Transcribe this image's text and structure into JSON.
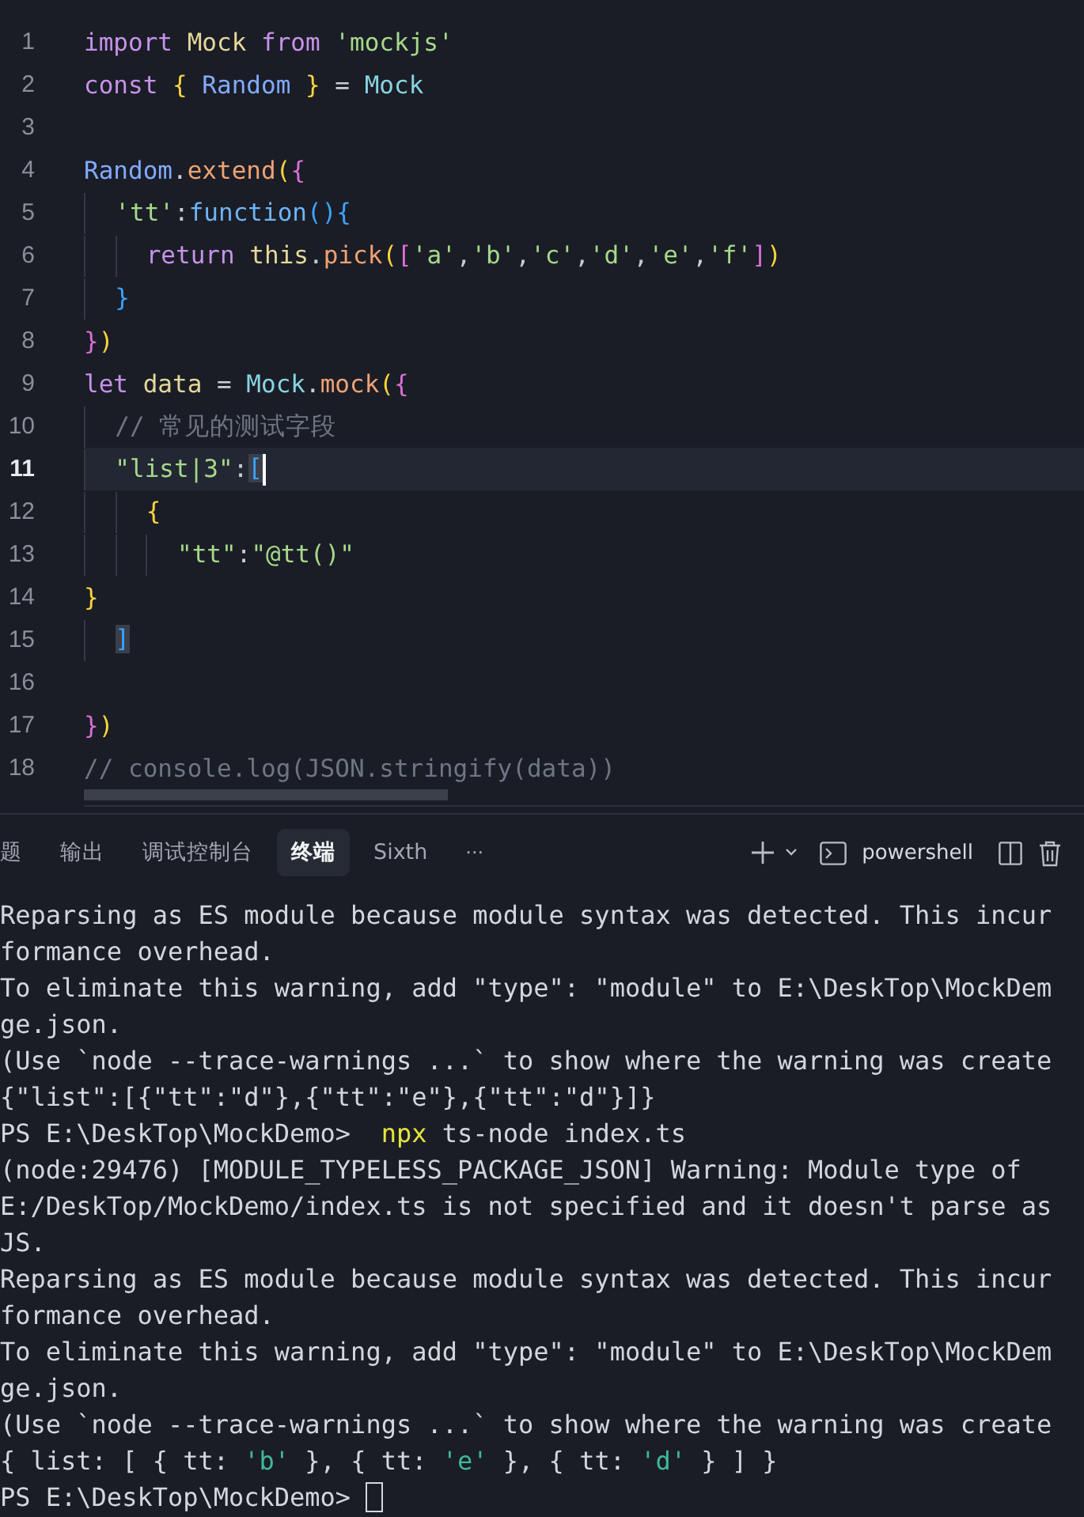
{
  "editor": {
    "lines": [
      {
        "number": "1",
        "current": false,
        "tokens": [
          {
            "kind": "kw",
            "text": "import"
          },
          {
            "kind": "ident",
            "text": " Mock"
          },
          {
            "kind": "kw",
            "text": " from"
          },
          {
            "kind": "str",
            "text": " 'mockjs'"
          }
        ]
      },
      {
        "number": "2",
        "current": false,
        "tokens": [
          {
            "kind": "kw",
            "text": "const"
          },
          {
            "kind": "b1",
            "text": " {"
          },
          {
            "kind": "var",
            "text": " Random"
          },
          {
            "kind": "b1",
            "text": " }"
          },
          {
            "kind": "plain",
            "text": " = "
          },
          {
            "kind": "type",
            "text": "Mock"
          }
        ]
      },
      {
        "number": "3",
        "current": false
      },
      {
        "number": "4",
        "current": false,
        "tokens": [
          {
            "kind": "var",
            "text": "Random"
          },
          {
            "kind": "plain",
            "text": "."
          },
          {
            "kind": "method",
            "text": "extend"
          },
          {
            "kind": "b1",
            "text": "("
          },
          {
            "kind": "b2",
            "text": "{"
          }
        ]
      },
      {
        "number": "5",
        "current": false,
        "tokens": [
          {
            "kind": "str",
            "text": "  'tt'"
          },
          {
            "kind": "plain",
            "text": ":"
          },
          {
            "kind": "fn",
            "text": "function"
          },
          {
            "kind": "b3",
            "text": "(){"
          }
        ]
      },
      {
        "number": "6",
        "current": false,
        "tokens": [
          {
            "kind": "kw",
            "text": "    return"
          },
          {
            "kind": "ident",
            "text": " this"
          },
          {
            "kind": "plain",
            "text": "."
          },
          {
            "kind": "method",
            "text": "pick"
          },
          {
            "kind": "b1",
            "text": "("
          },
          {
            "kind": "b2",
            "text": "["
          },
          {
            "kind": "str",
            "text": "'a'"
          },
          {
            "kind": "plain",
            "text": ","
          },
          {
            "kind": "str",
            "text": "'b'"
          },
          {
            "kind": "plain",
            "text": ","
          },
          {
            "kind": "str",
            "text": "'c'"
          },
          {
            "kind": "plain",
            "text": ","
          },
          {
            "kind": "str",
            "text": "'d'"
          },
          {
            "kind": "plain",
            "text": ","
          },
          {
            "kind": "str",
            "text": "'e'"
          },
          {
            "kind": "plain",
            "text": ","
          },
          {
            "kind": "str",
            "text": "'f'"
          },
          {
            "kind": "b2",
            "text": "]"
          },
          {
            "kind": "b1",
            "text": ")"
          }
        ]
      },
      {
        "number": "7",
        "current": false,
        "tokens": [
          {
            "kind": "b3",
            "text": "  }"
          }
        ]
      },
      {
        "number": "8",
        "current": false,
        "tokens": [
          {
            "kind": "b2",
            "text": "}"
          },
          {
            "kind": "b1",
            "text": ")"
          }
        ]
      },
      {
        "number": "9",
        "current": false,
        "tokens": [
          {
            "kind": "kw",
            "text": "let"
          },
          {
            "kind": "ident",
            "text": " data"
          },
          {
            "kind": "plain",
            "text": " = "
          },
          {
            "kind": "type",
            "text": "Mock"
          },
          {
            "kind": "plain",
            "text": "."
          },
          {
            "kind": "method",
            "text": "mock"
          },
          {
            "kind": "b1",
            "text": "("
          },
          {
            "kind": "b2",
            "text": "{"
          }
        ]
      },
      {
        "number": "10",
        "current": false,
        "tokens": [
          {
            "kind": "cmt",
            "text": "  // 常见的测试字段"
          }
        ]
      },
      {
        "number": "11",
        "current": true,
        "tokens": [
          {
            "kind": "str",
            "text": "  \"list|3\""
          },
          {
            "kind": "plain",
            "text": ":"
          },
          {
            "kind": "match",
            "text": "["
          }
        ]
      },
      {
        "number": "12",
        "current": false,
        "tokens": [
          {
            "kind": "b1",
            "text": "    {"
          }
        ]
      },
      {
        "number": "13",
        "current": false,
        "tokens": [
          {
            "kind": "str",
            "text": "      \"tt\""
          },
          {
            "kind": "plain",
            "text": ":"
          },
          {
            "kind": "str",
            "text": "\"@tt()\""
          }
        ]
      },
      {
        "number": "14",
        "current": false,
        "tokens": [
          {
            "kind": "b1",
            "text": "}"
          }
        ]
      },
      {
        "number": "15",
        "current": false,
        "tokens": [
          {
            "kind": "match",
            "text": "  ]"
          }
        ]
      },
      {
        "number": "16",
        "current": false
      },
      {
        "number": "17",
        "current": false,
        "tokens": [
          {
            "kind": "b2",
            "text": "}"
          },
          {
            "kind": "b1",
            "text": ")"
          }
        ]
      },
      {
        "number": "18",
        "current": false,
        "tokens": [
          {
            "kind": "cmt",
            "text": "// console.log(JSON.stringify(data))"
          }
        ]
      }
    ]
  },
  "panel": {
    "tabs": [
      {
        "label": "题",
        "selected": false
      },
      {
        "label": "输出",
        "selected": false
      },
      {
        "label": "调试控制台",
        "selected": false
      },
      {
        "label": "终端",
        "selected": true
      },
      {
        "label": "Sixth",
        "selected": false
      }
    ],
    "more": "···",
    "shell": "powershell"
  },
  "terminal": {
    "cursor_visible": true,
    "lines": [
      [
        {
          "kind": "plain",
          "text": "Reparsing as ES module because module syntax was detected. This incur"
        }
      ],
      [
        {
          "kind": "plain",
          "text": "formance overhead."
        }
      ],
      [
        {
          "kind": "plain",
          "text": "To eliminate this warning, add \"type\": \"module\" to E:\\DeskTop\\MockDem"
        }
      ],
      [
        {
          "kind": "plain",
          "text": "ge.json."
        }
      ],
      [
        {
          "kind": "plain",
          "text": "(Use `node --trace-warnings ...` to show where the warning was create"
        }
      ],
      [
        {
          "kind": "plain",
          "text": "{\"list\":[{\"tt\":\"d\"},{\"tt\":\"e\"},{\"tt\":\"d\"}]}"
        }
      ],
      [
        {
          "kind": "plain",
          "text": "PS E:\\DeskTop\\MockDemo>  "
        },
        {
          "kind": "cmd",
          "text": "npx"
        },
        {
          "kind": "plain",
          "text": " ts-node index.ts"
        }
      ],
      [
        {
          "kind": "plain",
          "text": "(node:29476) [MODULE_TYPELESS_PACKAGE_JSON] Warning: Module type of"
        }
      ],
      [
        {
          "kind": "plain",
          "text": "E:/DeskTop/MockDemo/index.ts is not specified and it doesn't parse as"
        }
      ],
      [
        {
          "kind": "plain",
          "text": "JS."
        }
      ],
      [
        {
          "kind": "plain",
          "text": "Reparsing as ES module because module syntax was detected. This incur"
        }
      ],
      [
        {
          "kind": "plain",
          "text": "formance overhead."
        }
      ],
      [
        {
          "kind": "plain",
          "text": "To eliminate this warning, add \"type\": \"module\" to E:\\DeskTop\\MockDem"
        }
      ],
      [
        {
          "kind": "plain",
          "text": "ge.json."
        }
      ],
      [
        {
          "kind": "plain",
          "text": "(Use `node --trace-warnings ...` to show where the warning was create"
        }
      ],
      [
        {
          "kind": "plain",
          "text": "{ list: [ { tt: "
        },
        {
          "kind": "str",
          "text": "'b'"
        },
        {
          "kind": "plain",
          "text": " }, { tt: "
        },
        {
          "kind": "str",
          "text": "'e'"
        },
        {
          "kind": "plain",
          "text": " }, { tt: "
        },
        {
          "kind": "str",
          "text": "'d'"
        },
        {
          "kind": "plain",
          "text": " } ] }"
        }
      ],
      [
        {
          "kind": "plain",
          "text": "PS E:\\DeskTop\\MockDemo> "
        }
      ]
    ]
  }
}
